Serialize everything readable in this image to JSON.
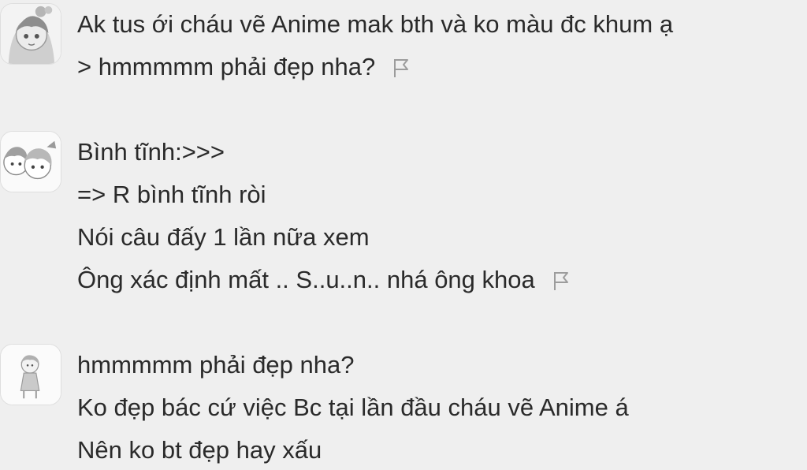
{
  "comments": [
    {
      "avatar_icon": "anime-girl-avatar-icon",
      "lines": [
        "Ak tus ới cháu vẽ Anime mak bth và ko màu đc khum ạ",
        "> hmmmmm phải đẹp nha?"
      ],
      "flag_icon": "report-flag-icon"
    },
    {
      "avatar_icon": "anime-couple-avatar-icon",
      "lines": [
        "Bình tĩnh:>>>",
        "=> R bình tĩnh ròi",
        "Nói câu đấy 1 lần nữa xem",
        "Ông xác định mất .. S..u..n.. nhá ông khoa"
      ],
      "flag_icon": "report-flag-icon"
    },
    {
      "avatar_icon": "chibi-figure-avatar-icon",
      "lines": [
        "hmmmmm phải đẹp nha?",
        "Ko đẹp bác cứ việc Bc tại lần đầu cháu vẽ Anime á",
        "Nên ko bt đẹp hay xấu"
      ]
    }
  ]
}
